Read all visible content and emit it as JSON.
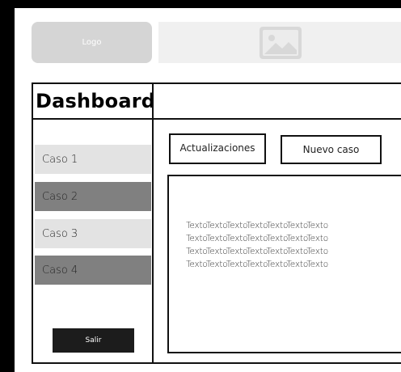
{
  "header": {
    "logo_label": "Logo",
    "banner_icon": "image-placeholder-icon"
  },
  "dashboard": {
    "title": "Dashboard"
  },
  "sidebar": {
    "items": [
      {
        "label": "Caso 1",
        "state": "light"
      },
      {
        "label": "Caso 2",
        "state": "dark"
      },
      {
        "label": "Caso 3",
        "state": "light"
      },
      {
        "label": "Caso 4",
        "state": "dark"
      }
    ],
    "exit_label": "Salir"
  },
  "content": {
    "updates_label": "Actualizaciones",
    "new_case_label": "Nuevo caso",
    "text_lines": [
      "TextoTextoTextoTextoTextoTextoTexto",
      "TextoTextoTextoTextoTextoTextoTexto",
      "TextoTextoTextoTextoTextoTextoTexto",
      "TextoTextoTextoTextoTextoTextoTexto"
    ]
  },
  "colors": {
    "logo_bg": "#d5d5d5",
    "banner_bg": "#f0f0f0",
    "item_light": "#e3e3e3",
    "item_dark": "#808080",
    "button_dark": "#1c1c1c"
  }
}
